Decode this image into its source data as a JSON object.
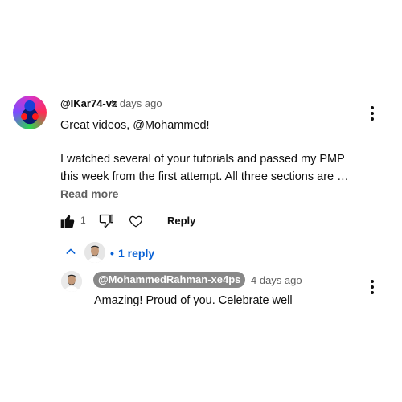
{
  "comment": {
    "author": "@IKar74-vz",
    "time": "5 days ago",
    "text_line1": "Great videos, @Mohammed!",
    "text_line2": "I watched several of your tutorials and passed my PMP",
    "text_line3": "this week from the first attempt. All three sections are …",
    "read_more": "Read more",
    "like_count": "1",
    "reply_label": "Reply"
  },
  "replies_toggle": {
    "label": "1 reply",
    "bullet": "•"
  },
  "reply": {
    "author": "@MohammedRahman-xe4ps",
    "time": "4 days ago",
    "text": "Amazing! Proud of you. Celebrate well"
  },
  "colors": {
    "link_blue": "#065fd4",
    "secondary_text": "#606060",
    "author_chip_bg": "#888888"
  },
  "icons": [
    "like-icon",
    "dislike-icon",
    "heart-icon",
    "chevron-up-icon",
    "kebab-menu-icon"
  ]
}
